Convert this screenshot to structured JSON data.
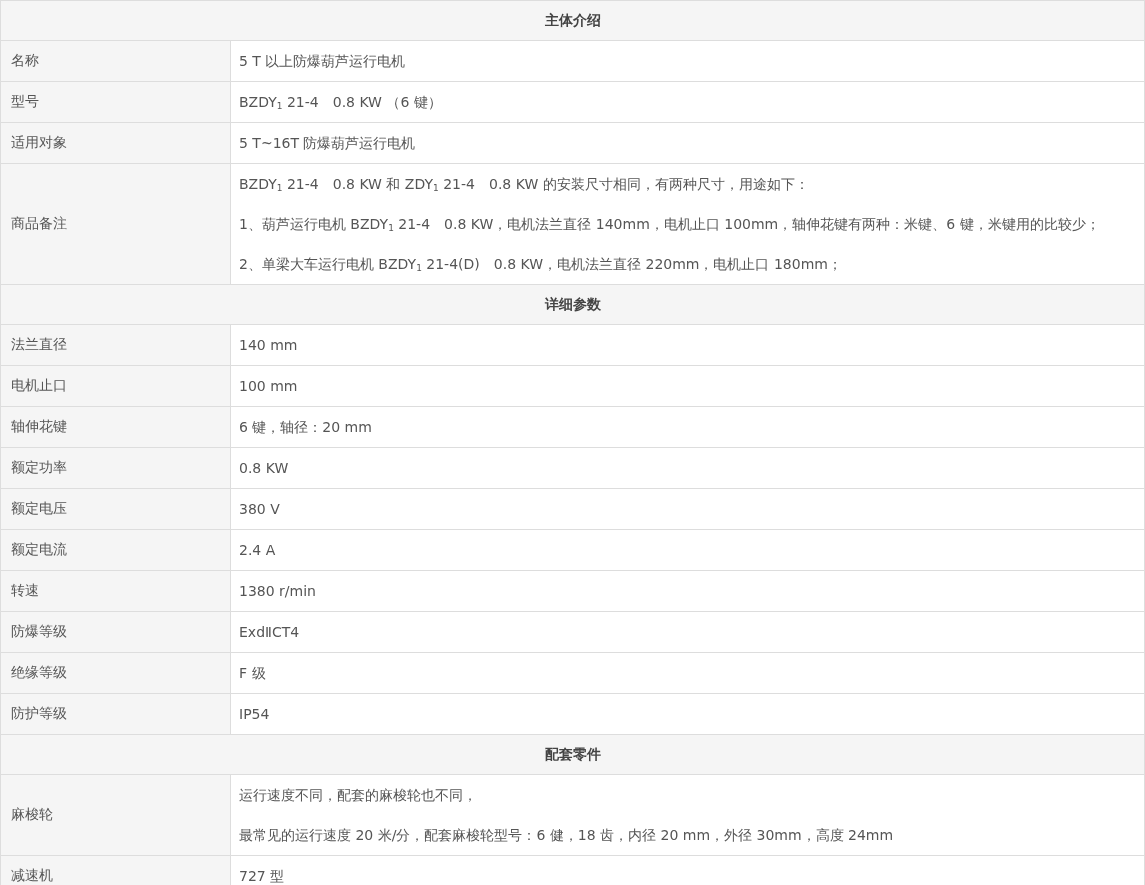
{
  "sections": [
    {
      "title": "主体介绍",
      "rows": [
        {
          "label": "名称",
          "lines": [
            "5 T 以上防爆葫芦运行电机"
          ]
        },
        {
          "label": "型号",
          "lines": [
            "BZDY$_{1}$ 21-4　0.8 KW （6 键）"
          ]
        },
        {
          "label": "适用对象",
          "lines": [
            "5 T~16T 防爆葫芦运行电机"
          ]
        },
        {
          "label": "商品备注",
          "lines": [
            "BZDY$_{1}$ 21-4　0.8 KW 和 ZDY$_{1}$ 21-4　0.8 KW 的安装尺寸相同，有两种尺寸，用途如下：",
            "1、葫芦运行电机 BZDY$_{1}$ 21-4　0.8 KW，电机法兰直径 140mm，电机止口 100mm，轴伸花键有两种：米键、6 键，米键用的比较少；",
            "2、单梁大车运行电机 BZDY$_{1}$ 21-4(D)　0.8 KW，电机法兰直径 220mm，电机止口 180mm；"
          ]
        }
      ]
    },
    {
      "title": "详细参数",
      "rows": [
        {
          "label": "法兰直径",
          "lines": [
            "140 mm"
          ]
        },
        {
          "label": "电机止口",
          "lines": [
            "100 mm"
          ]
        },
        {
          "label": "轴伸花键",
          "lines": [
            "6 键，轴径：20 mm"
          ]
        },
        {
          "label": "额定功率",
          "lines": [
            "0.8 KW"
          ]
        },
        {
          "label": "额定电压",
          "lines": [
            "380 V"
          ]
        },
        {
          "label": "额定电流",
          "lines": [
            "2.4 A"
          ]
        },
        {
          "label": "转速",
          "lines": [
            "1380 r/min"
          ]
        },
        {
          "label": "防爆等级",
          "lines": [
            "ExdⅡCT4"
          ]
        },
        {
          "label": "绝缘等级",
          "lines": [
            "F 级"
          ]
        },
        {
          "label": "防护等级",
          "lines": [
            "IP54"
          ]
        }
      ]
    },
    {
      "title": "配套零件",
      "rows": [
        {
          "label": "麻梭轮",
          "lines": [
            "运行速度不同，配套的麻梭轮也不同，",
            "最常见的运行速度 20 米/分，配套麻梭轮型号：6 健，18 齿，内径 20 mm，外径 30mm，高度 24mm"
          ]
        },
        {
          "label": "减速机",
          "lines": [
            "727 型"
          ]
        }
      ]
    }
  ]
}
